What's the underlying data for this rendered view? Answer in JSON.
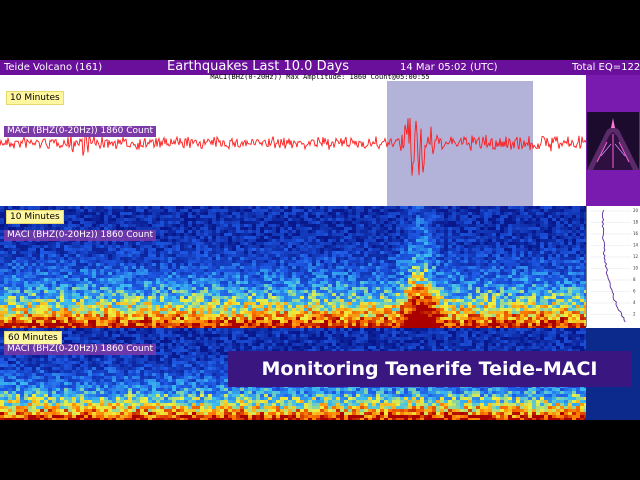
{
  "header": {
    "station": "Teide Volcano (161)",
    "title": "Earthquakes Last 10.0 Days",
    "datetime": "14 Mar 05:02 (UTC)",
    "total": "Total EQ=122"
  },
  "subtitle": "MACI(BHZ(0-20Hz)) Max Amplitude: 1860 Count@05:00:55",
  "panels": {
    "seismogram": {
      "window_label": "10 Minutes",
      "channel_label": "MACI (BHZ(0-20Hz)) 1860 Count"
    },
    "spectrogram_10": {
      "window_label": "10 Minutes",
      "channel_label": "MACI (BHZ(0-20Hz)) 1860 Count"
    },
    "spectrogram_60": {
      "window_label": "60 Minutes",
      "channel_label": "MACI (BHZ(0-20Hz)) 1860 Count"
    }
  },
  "mini_chart_ticks": [
    "20",
    "18",
    "16",
    "14",
    "12",
    "10",
    "8",
    "6",
    "4",
    "2"
  ],
  "banner": "Monitoring Tenerife Teide-MACI",
  "colors": {
    "header_bg": "#6a0f9b",
    "trace": "#ff1a1a",
    "highlight": "#b3b3da",
    "banner_bg": "#3a1780",
    "spectrogram_low": "#0a1e8c",
    "spectrogram_high": "#b00000"
  }
}
